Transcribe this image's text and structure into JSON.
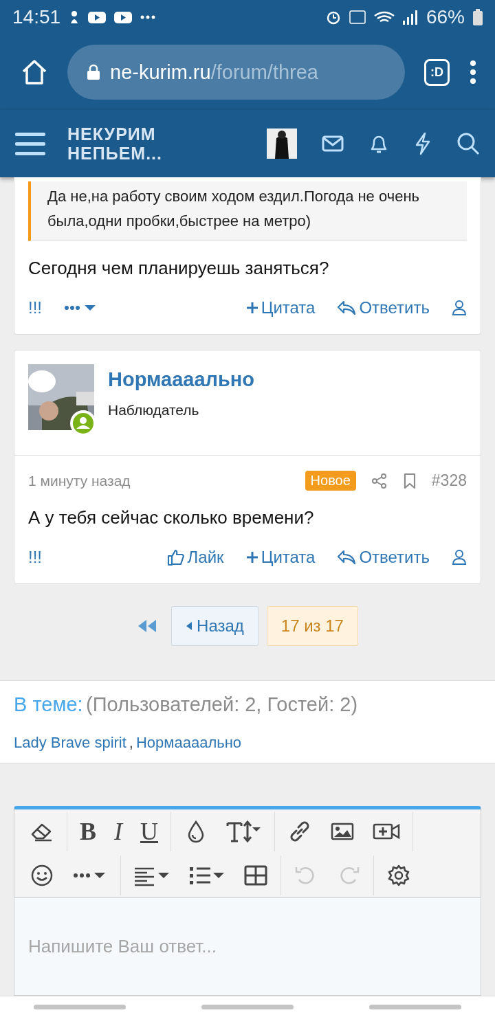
{
  "status_bar": {
    "time": "14:51",
    "battery": "66%"
  },
  "browser": {
    "url_host": "ne-kurim.ru",
    "url_path": "/forum/threa",
    "tab_badge": ":D"
  },
  "site_header": {
    "logo_line_1": "НЕКУРИМ",
    "logo_line_2": "НЕПЬЕМ..."
  },
  "posts": [
    {
      "kind": "continued",
      "quote": "Да не,на работу своим ходом ездил.Погода не очень была,одни пробки,быстрее на метро)",
      "body": "Сегодня чем планируешь заняться?",
      "actions": {
        "flag": "!!!",
        "quote": "Цитата",
        "reply": "Ответить"
      }
    },
    {
      "kind": "full",
      "author": "Нормаааально",
      "role": "Наблюдатель",
      "online": true,
      "time": "1 минуту назад",
      "badge": "Новое",
      "number": "#328",
      "body": "А у тебя сейчас сколько времени?",
      "actions": {
        "flag": "!!!",
        "like": "Лайк",
        "quote": "Цитата",
        "reply": "Ответить"
      }
    }
  ],
  "pagination": {
    "prev": "Назад",
    "page": "17 из 17"
  },
  "in_thread": {
    "label": "В теме:",
    "counts": "(Пользователей: 2, Гостей: 2)",
    "users": [
      "Lady Brave spirit",
      "Нормаааально"
    ],
    "separator": ","
  },
  "editor": {
    "bold": "B",
    "italic": "I",
    "underline": "U",
    "undo_disabled": true,
    "redo_disabled": true,
    "placeholder": "Напишите Ваш ответ..."
  }
}
